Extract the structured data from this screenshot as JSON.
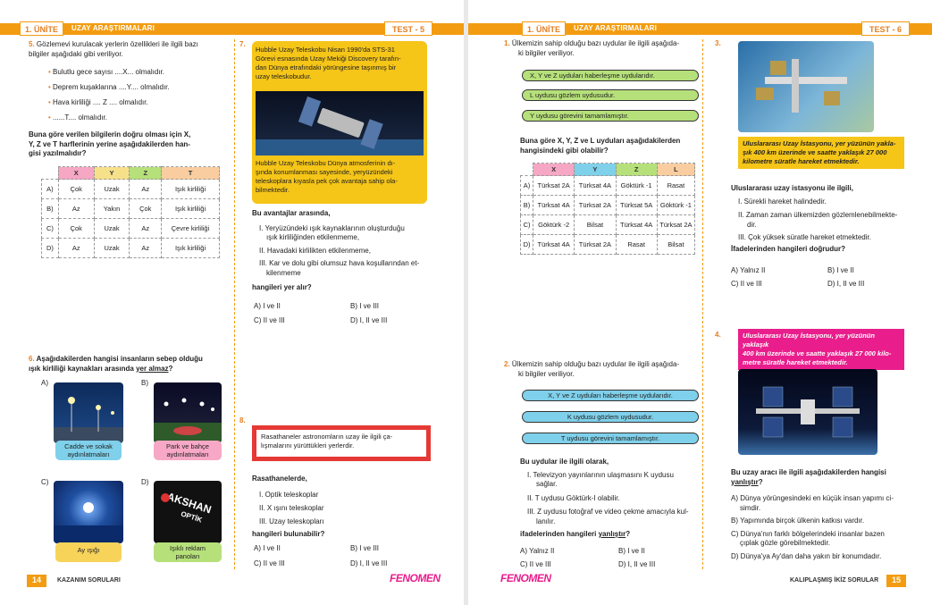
{
  "left": {
    "unit": "1. ÜNİTE",
    "unit_title": "UZAY ARAŞTIRMALARI",
    "test": "TEST - 5",
    "page_number": "14",
    "footer_label": "KAZANIM SORULARI",
    "brand": "FENOMEN",
    "q5": {
      "num": "5.",
      "intro1": "Gözlemevi kurulacak yerlerin özellikleri ile ilgili bazı",
      "intro2": "bilgiler aşağıdaki gibi veriliyor.",
      "bullets": [
        "Bulutlu gece sayısı ....X... olmalıdır.",
        "Deprem kuşaklarına ....Y.... olmalıdır.",
        "Hava kirliliği .... Z .... olmalıdır.",
        "......T.... olmalıdır."
      ],
      "stem1": "Buna göre verilen bilgilerin doğru olması için X,",
      "stem2": "Y, Z ve T harflerinin yerine aşağıdakilerden han-",
      "stem3": "gisi yazılmalıdır?",
      "headers": [
        "X",
        "Y",
        "Z",
        "T"
      ],
      "rows": [
        {
          "opt": "A)",
          "cells": [
            "Çok",
            "Uzak",
            "Az",
            "Işık kirliliği"
          ]
        },
        {
          "opt": "B)",
          "cells": [
            "Az",
            "Yakın",
            "Çok",
            "Işık kirliliği"
          ]
        },
        {
          "opt": "C)",
          "cells": [
            "Çok",
            "Uzak",
            "Az",
            "Çevre kirliliği"
          ]
        },
        {
          "opt": "D)",
          "cells": [
            "Az",
            "Uzak",
            "Az",
            "Işık kirliliği"
          ]
        }
      ]
    },
    "q6": {
      "num": "6.",
      "stem1": "Aşağıdakilerden hangisi insanların sebep olduğu",
      "stem2": "ışık kirliliği kaynakları arasında ",
      "stem_u": "yer almaz",
      "stem3": "?",
      "opts": [
        {
          "letter": "A)",
          "caption1": "Cadde ve sokak",
          "caption2": "aydınlatmaları"
        },
        {
          "letter": "B)",
          "caption1": "Park ve bahçe",
          "caption2": "aydınlatmaları"
        },
        {
          "letter": "C)",
          "caption1": "Ay ışığı",
          "caption2": ""
        },
        {
          "letter": "D)",
          "caption1": "Işıklı reklam",
          "caption2": "panoları"
        }
      ],
      "sign1": "AKSHAN",
      "sign2": "OPTİK"
    },
    "q7": {
      "num": "7.",
      "box": [
        "Hubble Uzay Teleskobu Nisan 1990'da STS-31",
        "Görevi esnasında Uzay Mekiği Discovery tarafın-",
        "dan Dünya etrafındaki yörüngesine taşınmış bir",
        "uzay teleskobudur."
      ],
      "box2": [
        "Hubble Uzay Teleskobu Dünya atmosferinin dı-",
        "şında konumlanması sayesinde, yeryüzündeki",
        "teleskoplara kıyasla pek çok avantaja sahip ola-",
        "bilmektedir."
      ],
      "lead": "Bu avantajlar arasında,",
      "items": [
        "I. Yeryüzündeki ışık kaynaklarının oluşturduğu",
        "ışık kirliliğinden etkilenmeme,",
        "II. Havadaki kirlilikten etkilenmeme,",
        "III. Kar ve dolu gibi olumsuz hava koşullarından et-",
        "kilenmeme"
      ],
      "ask": "hangileri yer alır?",
      "answers": [
        "A) I ve II",
        "B) I ve III",
        "C) II ve III",
        "D) I, II ve III"
      ]
    },
    "q8": {
      "num": "8.",
      "box": [
        "Rasathaneler astronomların uzay ile ilgili ça-",
        "lışmalarını yürüttükleri yerlerdir."
      ],
      "lead": "Rasathanelerde,",
      "items": [
        "I. Optik teleskoplar",
        "II. X ışını teleskoplar",
        "III. Uzay teleskopları"
      ],
      "ask": "hangileri bulunabilir?",
      "answers": [
        "A) I ve II",
        "B) I ve III",
        "C) II ve III",
        "D) I, II ve III"
      ]
    }
  },
  "right": {
    "unit": "1. ÜNİTE",
    "unit_title": "UZAY ARAŞTIRMALARI",
    "test": "TEST - 6",
    "page_number": "15",
    "footer_label": "KALIPLAŞMIŞ İKİZ SORULAR",
    "brand": "FENOMEN",
    "q1": {
      "num": "1.",
      "intro1": "Ülkemizin sahip olduğu bazı uydular ile ilgili aşağıda-",
      "intro2": "ki bilgiler veriliyor.",
      "pills": [
        "X, Y ve Z uyduları haberleşme uydularıdır.",
        "L uydusu gözlem uydusudur.",
        "Y uydusu görevini tamamlamıştır."
      ],
      "stem1": "Buna göre X, Y, Z ve L uyduları aşağıdakilerden",
      "stem2": "hangisindeki gibi olabilir?",
      "headers": [
        "X",
        "Y",
        "Z",
        "L"
      ],
      "rows": [
        {
          "opt": "A)",
          "cells": [
            "Türksat 2A",
            "Türksat 4A",
            "Göktürk -1",
            "Rasat"
          ]
        },
        {
          "opt": "B)",
          "cells": [
            "Türksat 4A",
            "Türksat 2A",
            "Türksat 5A",
            "Göktürk -1"
          ]
        },
        {
          "opt": "C)",
          "cells": [
            "Göktürk -2",
            "Bilsat",
            "Türksat 4A",
            "Türksat 2A"
          ]
        },
        {
          "opt": "D)",
          "cells": [
            "Türksat 4A",
            "Türksat 2A",
            "Rasat",
            "Bilsat"
          ]
        }
      ]
    },
    "q2": {
      "num": "2.",
      "intro1": "Ülkemizin sahip olduğu bazı uydular ile ilgili aşağıda-",
      "intro2": "ki bilgiler veriliyor.",
      "pills": [
        "X, Y ve Z uyduları haberleşme uydularıdır.",
        "K uydusu gözlem uydusudur.",
        "T uydusu görevini tamamlamıştır."
      ],
      "lead": "Bu uydular ile ilgili olarak,",
      "items": [
        "I. Televizyon yayınlarının ulaşmasını K uydusu",
        "sağlar.",
        "II. T uydusu Göktürk-I olabilir.",
        "III. Z uydusu fotoğraf ve video çekme amacıyla kul-",
        "lanılır."
      ],
      "ask_pre": "ifadelerinden hangileri ",
      "ask_u": "yanlıştır",
      "ask_post": "?",
      "answers": [
        "A) Yalnız II",
        "B) I ve II",
        "C) II ve III",
        "D) I, II ve III"
      ]
    },
    "q3": {
      "num": "3.",
      "box": [
        "Uluslararası Uzay İstasyonu, yer yüzünün yakla-",
        "şık 400 km üzerinde ve saatte yaklaşık 27 000",
        "kilometre süratle hareket etmektedir."
      ],
      "lead": "Uluslararası uzay istasyonu ile ilgili,",
      "items": [
        "I. Sürekli hareket halindedir.",
        "II. Zaman zaman ülkemizden gözlemlenebilmekte-",
        "dir.",
        "III. Çok yüksek süratle hareket etmektedir."
      ],
      "ask": "İfadelerinden hangileri doğrudur?",
      "answers": [
        "A) Yalnız II",
        "B) I ve II",
        "C) II ve III",
        "D) I, II ve III"
      ]
    },
    "q4": {
      "num": "4.",
      "box": [
        "Uluslararası Uzay İstasyonu, yer yüzünün yaklaşık",
        "400 km üzerinde ve saatte yaklaşık 27 000 kilo-",
        "metre süratle hareket etmektedir."
      ],
      "stem1": "Bu uzay aracı ile ilgili aşağıdakilerden hangisi",
      "stem_u": "yanlıştır",
      "stem2": "?",
      "answers": [
        "A) Dünya yörüngesindeki en küçük insan yapımı ci-",
        "simdir.",
        "B) Yapımında birçok ülkenin katkısı vardır.",
        "C) Dünya'nın farklı bölgelerindeki insanlar bazen",
        "çıplak gözle görebilmektedir.",
        "D) Dünya'ya Ay'dan daha yakın bir konumdadır."
      ]
    }
  }
}
